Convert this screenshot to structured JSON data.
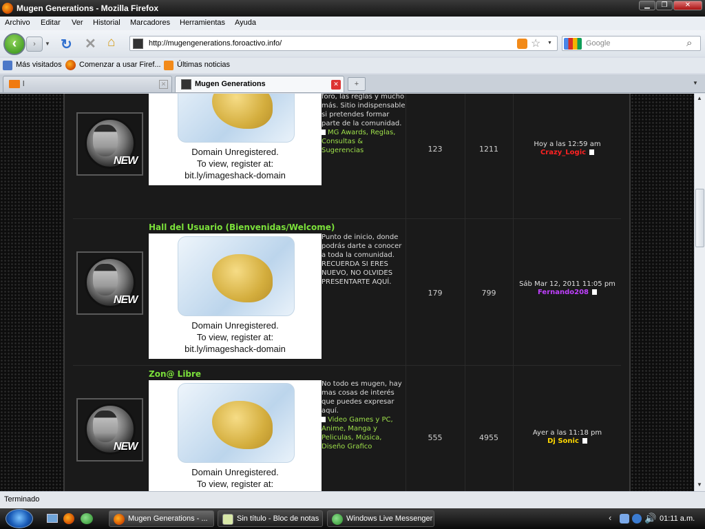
{
  "window": {
    "title": "Mugen Generations - Mozilla Firefox"
  },
  "menu": [
    "Archivo",
    "Editar",
    "Ver",
    "Historial",
    "Marcadores",
    "Herramientas",
    "Ayuda"
  ],
  "nav": {
    "url": "http://mugengenerations.foroactivo.info/",
    "search_placeholder": "Google"
  },
  "bookmarks": [
    "Más visitados",
    "Comenzar a usar Firef...",
    "Últimas noticias"
  ],
  "tabs": [
    {
      "label": "l",
      "active": false
    },
    {
      "label": "Mugen Generations",
      "active": true
    }
  ],
  "forums": [
    {
      "name": "",
      "description": "foro, las reglas y mucho más. Sitio indispensable si pretendes formar parte de la comunidad.",
      "subforums": "MG Awards, Reglas, Consultas & Sugerencias",
      "image_caption": [
        "Domain Unregistered.",
        "To view, register at:",
        "bit.ly/imageshack-domain"
      ],
      "topics": "123",
      "posts": "1211",
      "last_post_date": "Hoy a las 12:59 am",
      "last_post_user": "Crazy_Logic",
      "user_color": "#ff2222"
    },
    {
      "name": "Hall del Usuario (Bienvenidas/Welcome)",
      "description": "Punto de inicio, donde podrás darte a conocer a toda la comunidad. RECUERDA SI ERES NUEVO, NO OLVIDES PRESENTARTE AQUÍ.",
      "subforums": "",
      "image_caption": [
        "Domain Unregistered.",
        "To view, register at:",
        "bit.ly/imageshack-domain"
      ],
      "topics": "179",
      "posts": "799",
      "last_post_date": "Sáb Mar 12, 2011 11:05 pm",
      "last_post_user": "Fernando208",
      "user_color": "#c040ff"
    },
    {
      "name": "Zon@ Libre",
      "description": "No todo es mugen, hay mas cosas de interés que puedes expresar aquí.",
      "subforums": "Video Games y PC, Anime, Manga y Peliculas, Música, Diseño Grafico",
      "image_caption": [
        "Domain Unregistered.",
        "To view, register at:"
      ],
      "topics": "555",
      "posts": "4955",
      "last_post_date": "Ayer a las 11:18 pm",
      "last_post_user": "Dj Sonic",
      "user_color": "#ffd800"
    }
  ],
  "status": "Terminado",
  "taskbar": {
    "items": [
      "Mugen Generations - ...",
      "Sin título - Bloc de notas",
      "Windows Live Messenger"
    ],
    "clock": "01:11 a.m."
  },
  "icons": [
    "firefox-icon",
    "back-icon",
    "forward-icon",
    "reload-icon",
    "stop-icon",
    "home-icon",
    "rss-icon",
    "star-icon",
    "search-icon",
    "close-tab-icon",
    "new-tab-icon",
    "start-orb-icon",
    "volume-icon"
  ]
}
